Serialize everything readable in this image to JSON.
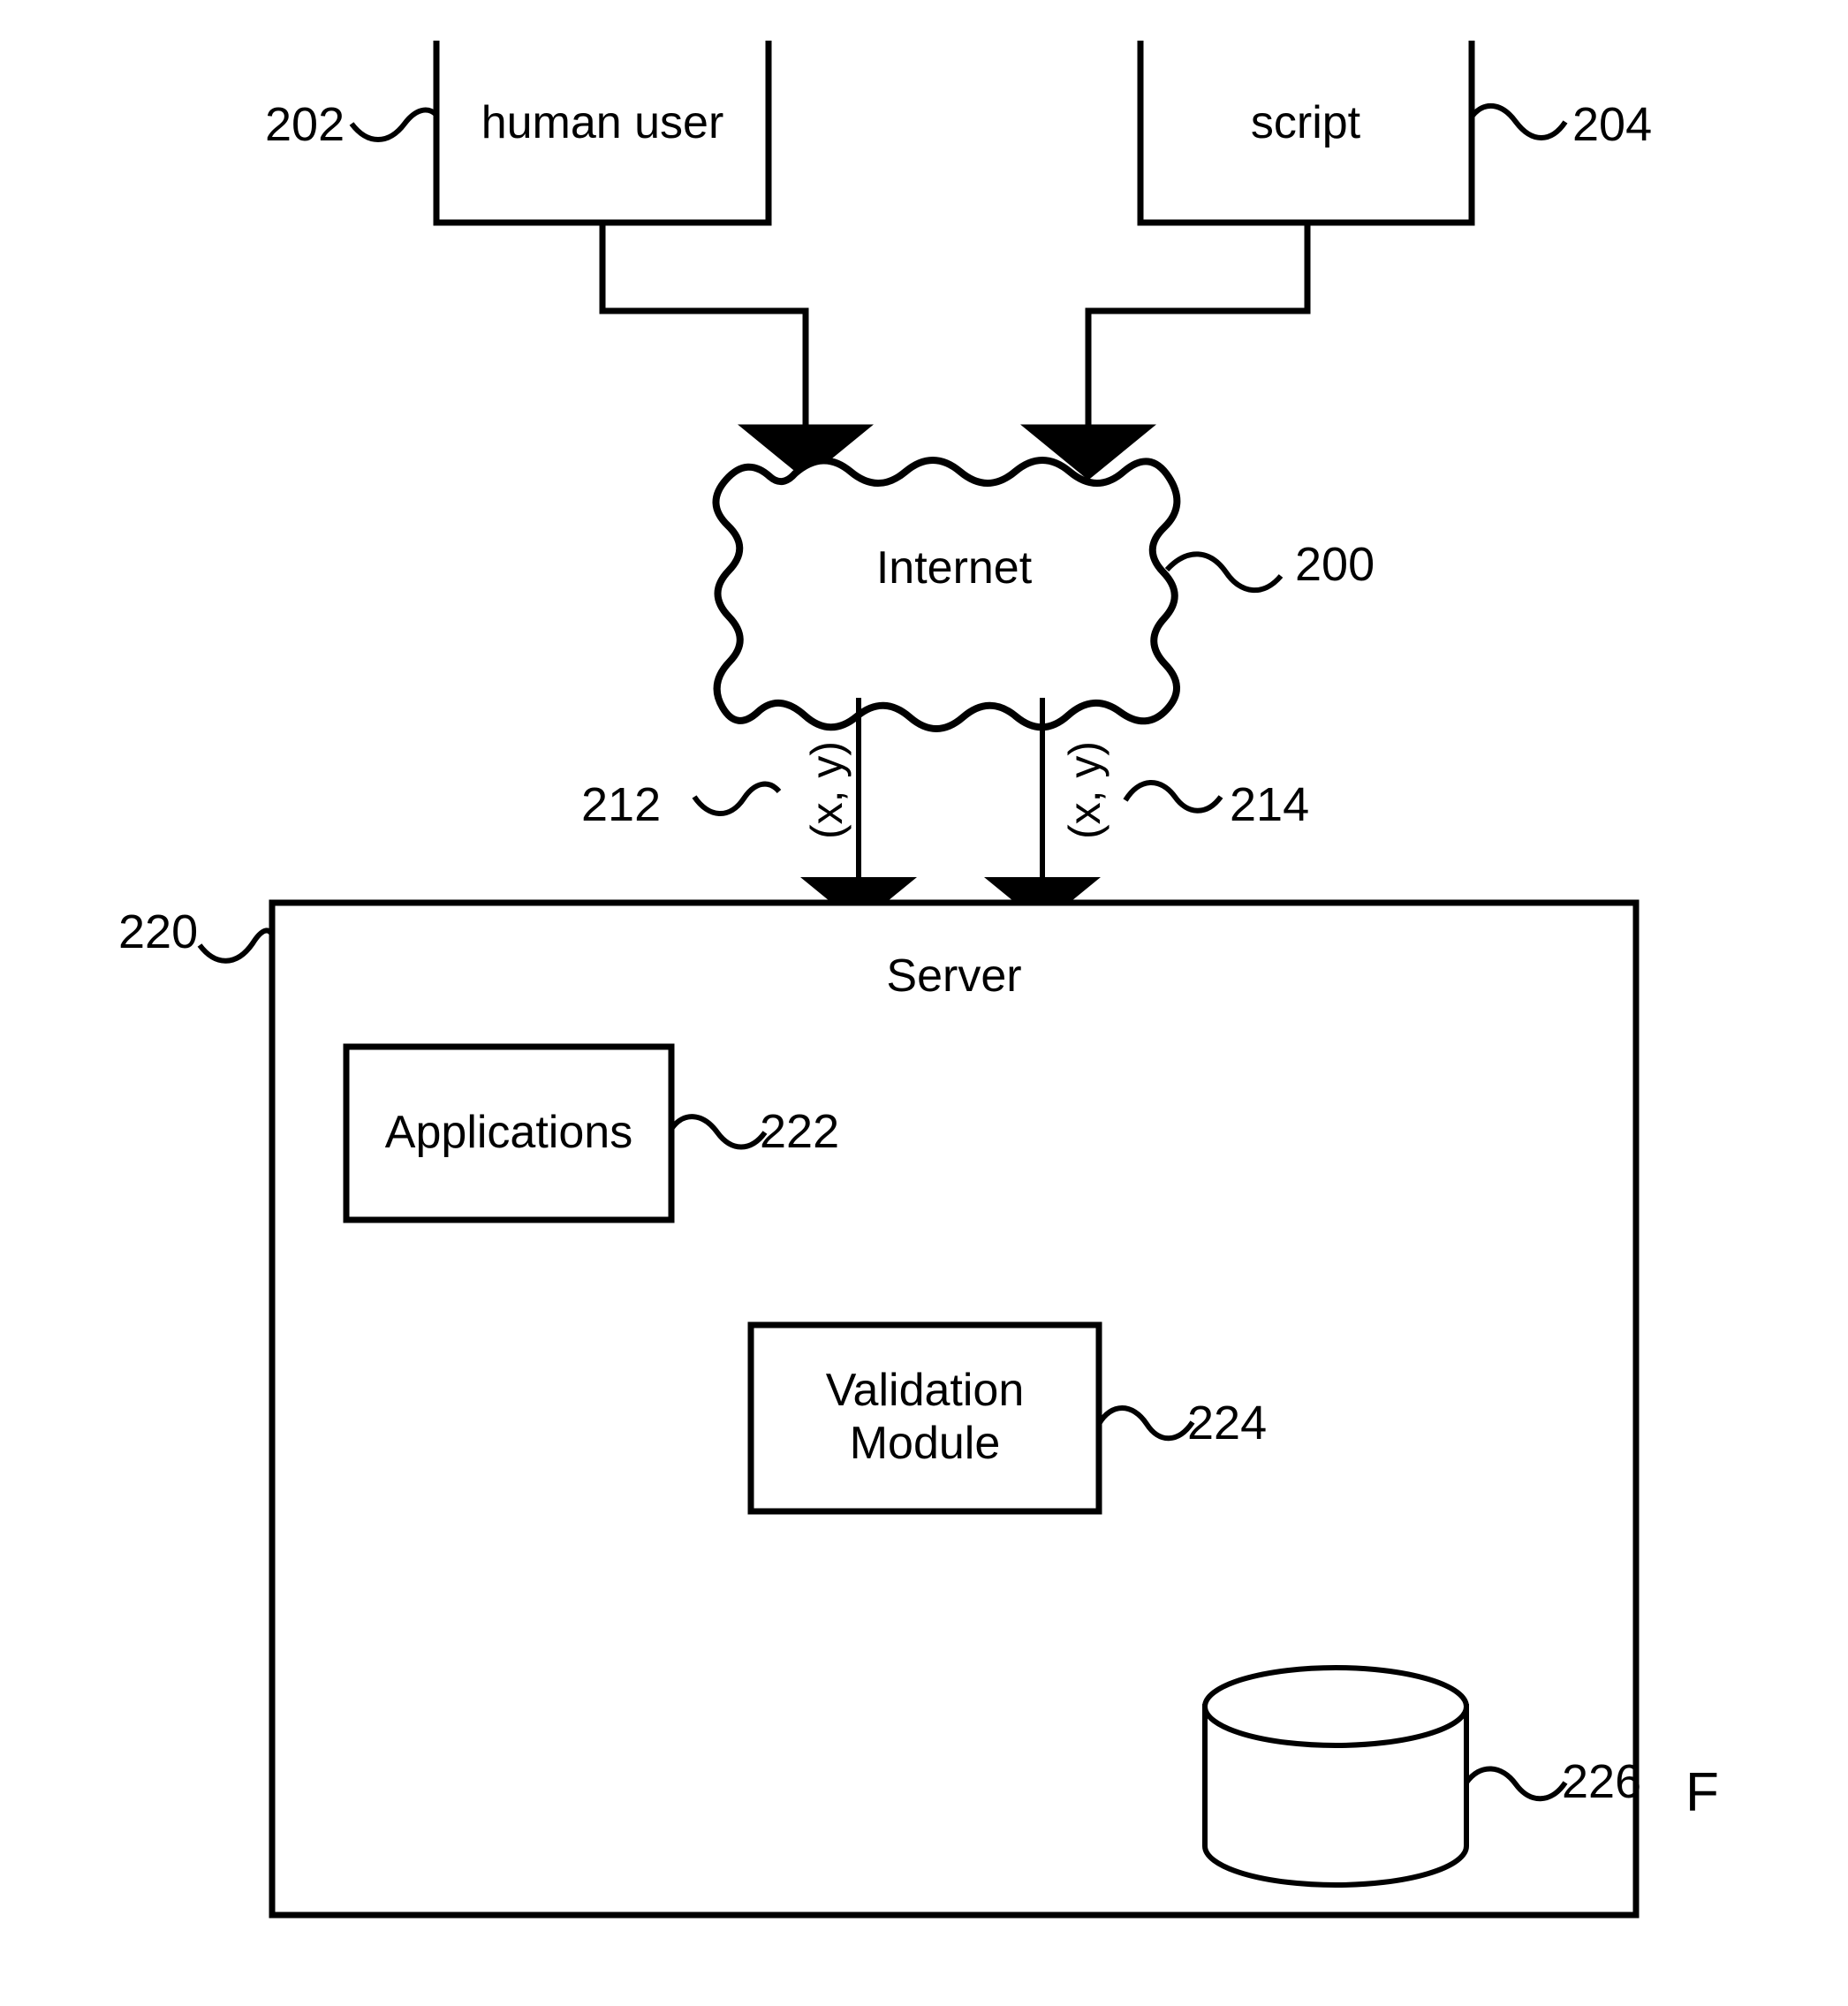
{
  "figure": {
    "type": "patent-system-diagram",
    "background_color": "#ffffff",
    "line_color": "#000000",
    "figure_mark": "F"
  },
  "nodes": {
    "human_user": {
      "label": "human user",
      "ref": "202"
    },
    "script": {
      "label": "script",
      "ref": "204"
    },
    "internet": {
      "label": "Internet",
      "ref": "200"
    },
    "server": {
      "label": "Server",
      "ref": "220"
    },
    "applications": {
      "label": "Applications",
      "ref": "222"
    },
    "validation_module": {
      "label_line1": "Validation",
      "label_line2": "Module",
      "ref": "224"
    },
    "database": {
      "label": "",
      "ref": "226"
    }
  },
  "flows": {
    "left_channel": {
      "label": "(x, y)",
      "ref": "212"
    },
    "right_channel": {
      "label": "(x, y)",
      "ref": "214"
    }
  }
}
